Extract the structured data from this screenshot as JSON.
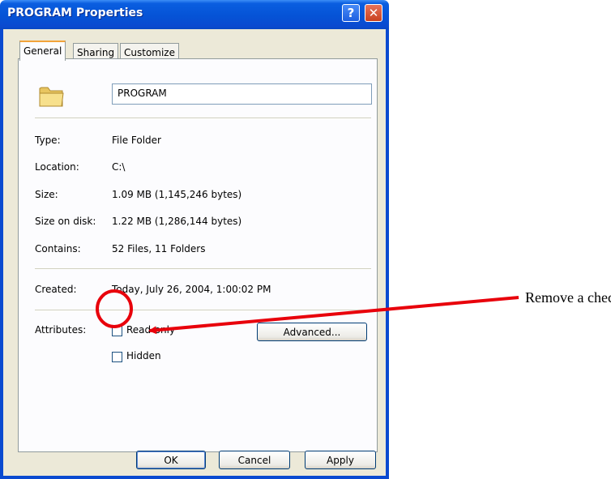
{
  "window": {
    "title": "PROGRAM Properties",
    "help_glyph": "?",
    "close_glyph": "✕"
  },
  "tabs": [
    {
      "label": "General",
      "active": true
    },
    {
      "label": "Sharing",
      "active": false
    },
    {
      "label": "Customize",
      "active": false
    }
  ],
  "general": {
    "folder_icon": "folder-icon",
    "name_value": "PROGRAM",
    "properties": [
      {
        "label": "Type:",
        "value": "File Folder"
      },
      {
        "label": "Location:",
        "value": "C:\\"
      },
      {
        "label": "Size:",
        "value": "1.09 MB (1,145,246 bytes)"
      },
      {
        "label": "Size on disk:",
        "value": "1.22 MB (1,286,144 bytes)"
      },
      {
        "label": "Contains:",
        "value": "52 Files, 11 Folders"
      }
    ],
    "created": {
      "label": "Created:",
      "value": "Today, July 26, 2004, 1:00:02 PM"
    },
    "attributes": {
      "label": "Attributes:",
      "read_only": {
        "label": "Read-only",
        "checked": false
      },
      "hidden": {
        "label": "Hidden",
        "checked": false
      },
      "advanced_label": "Advanced..."
    }
  },
  "footer": {
    "ok_label": "OK",
    "cancel_label": "Cancel",
    "apply_label": "Apply"
  },
  "annotation": {
    "text": "Remove a check",
    "color": "#e8000b"
  }
}
